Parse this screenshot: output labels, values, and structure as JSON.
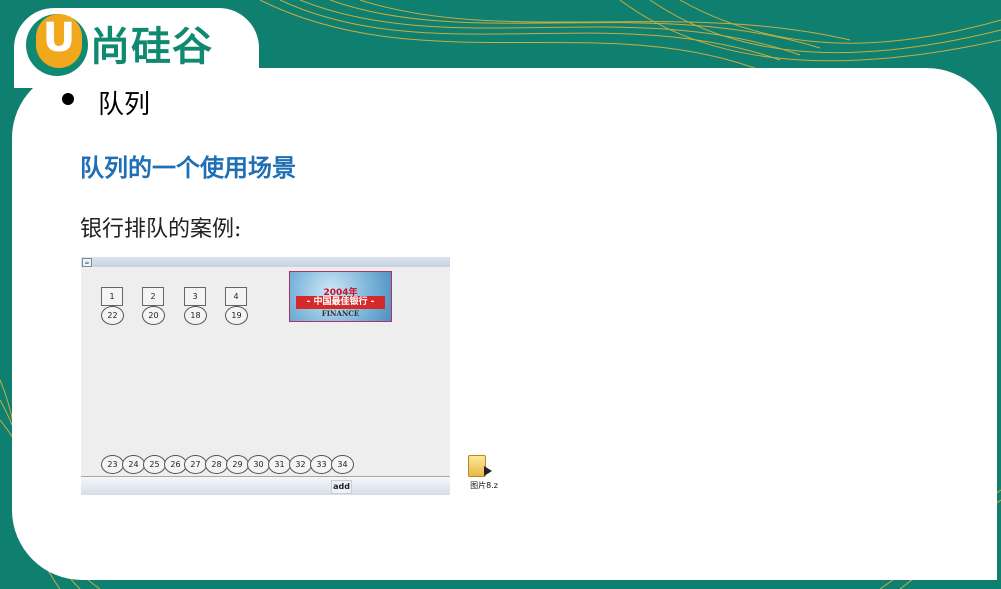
{
  "slide": {
    "logo_letter": "U",
    "logo_text": "尚硅谷",
    "bullet_title": "队列",
    "subtitle": "队列的一个使用场景",
    "body_text": "银行排队的案例:",
    "colors": {
      "background": "#0f7f6f",
      "accent_blue": "#1f6fb5",
      "logo_green": "#0f8a70",
      "logo_orange": "#f2a81d"
    }
  },
  "app": {
    "title_icon": "java-cup-icon",
    "windows": [
      {
        "label": "1",
        "serving": "22"
      },
      {
        "label": "2",
        "serving": "20"
      },
      {
        "label": "3",
        "serving": "18"
      },
      {
        "label": "4",
        "serving": "19"
      }
    ],
    "banner": {
      "year": "2004年",
      "title": "- 中国最佳银行 -",
      "english": "FINANCE"
    },
    "queue": [
      "23",
      "24",
      "25",
      "26",
      "27",
      "28",
      "29",
      "30",
      "31",
      "32",
      "33",
      "34"
    ],
    "add_label": "add"
  },
  "desktop_file": {
    "icon": "folder-shortcut-icon",
    "label": "图片8.z"
  }
}
